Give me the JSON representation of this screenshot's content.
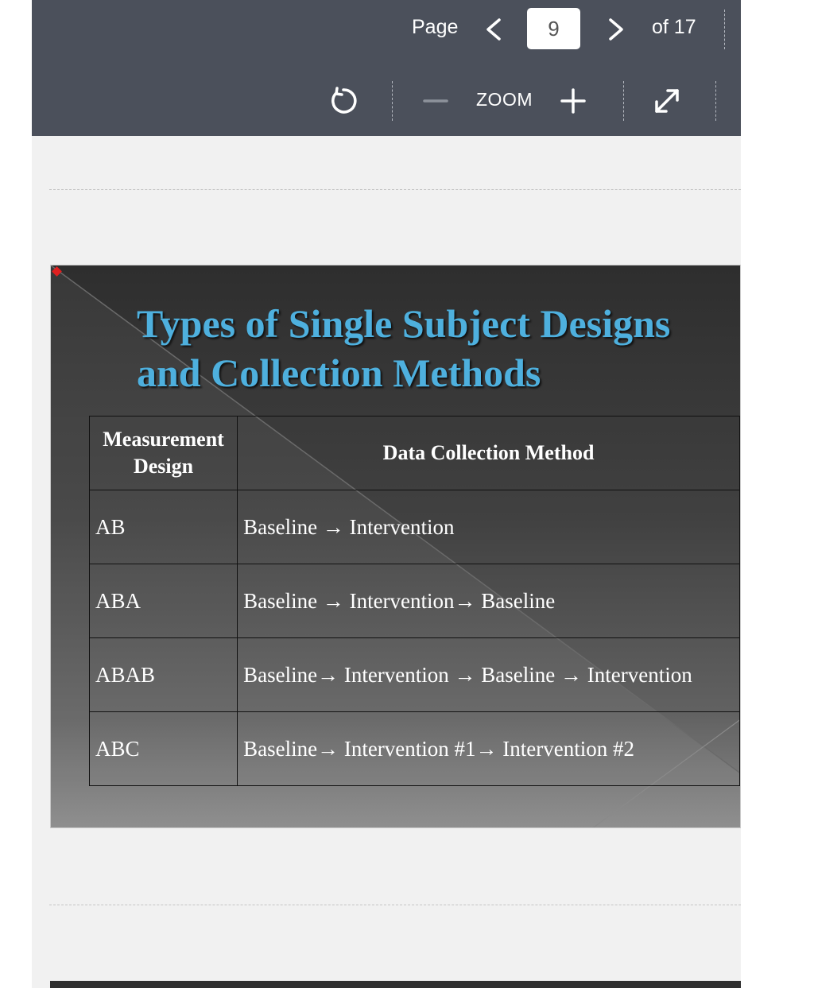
{
  "toolbar": {
    "page_label": "Page",
    "current_page": "9",
    "page_total": "of 17",
    "zoom_label": "ZOOM",
    "icons": {
      "prev": "chevron-left-icon",
      "next": "chevron-right-icon",
      "rotate": "rotate-icon",
      "zoom_out": "minus-icon",
      "zoom_in": "plus-icon",
      "expand": "expand-icon"
    }
  },
  "slide": {
    "title_line1": "Types of Single Subject Designs",
    "title_line2": "and Collection Methods",
    "table": {
      "headers": [
        "Measurement Design",
        "Data Collection Method"
      ],
      "rows": [
        [
          "AB",
          "Baseline → Intervention"
        ],
        [
          "ABA",
          "Baseline → Intervention→  Baseline"
        ],
        [
          "ABAB",
          "Baseline→  Intervention → Baseline → Intervention"
        ],
        [
          "ABC",
          "Baseline→  Intervention #1→ Intervention #2"
        ]
      ]
    }
  },
  "colors": {
    "toolbar_bg": "#4b505b",
    "viewer_bg": "#f1f1f1",
    "title_color": "#4eb0de",
    "page_input_bg": "#ffffff"
  }
}
